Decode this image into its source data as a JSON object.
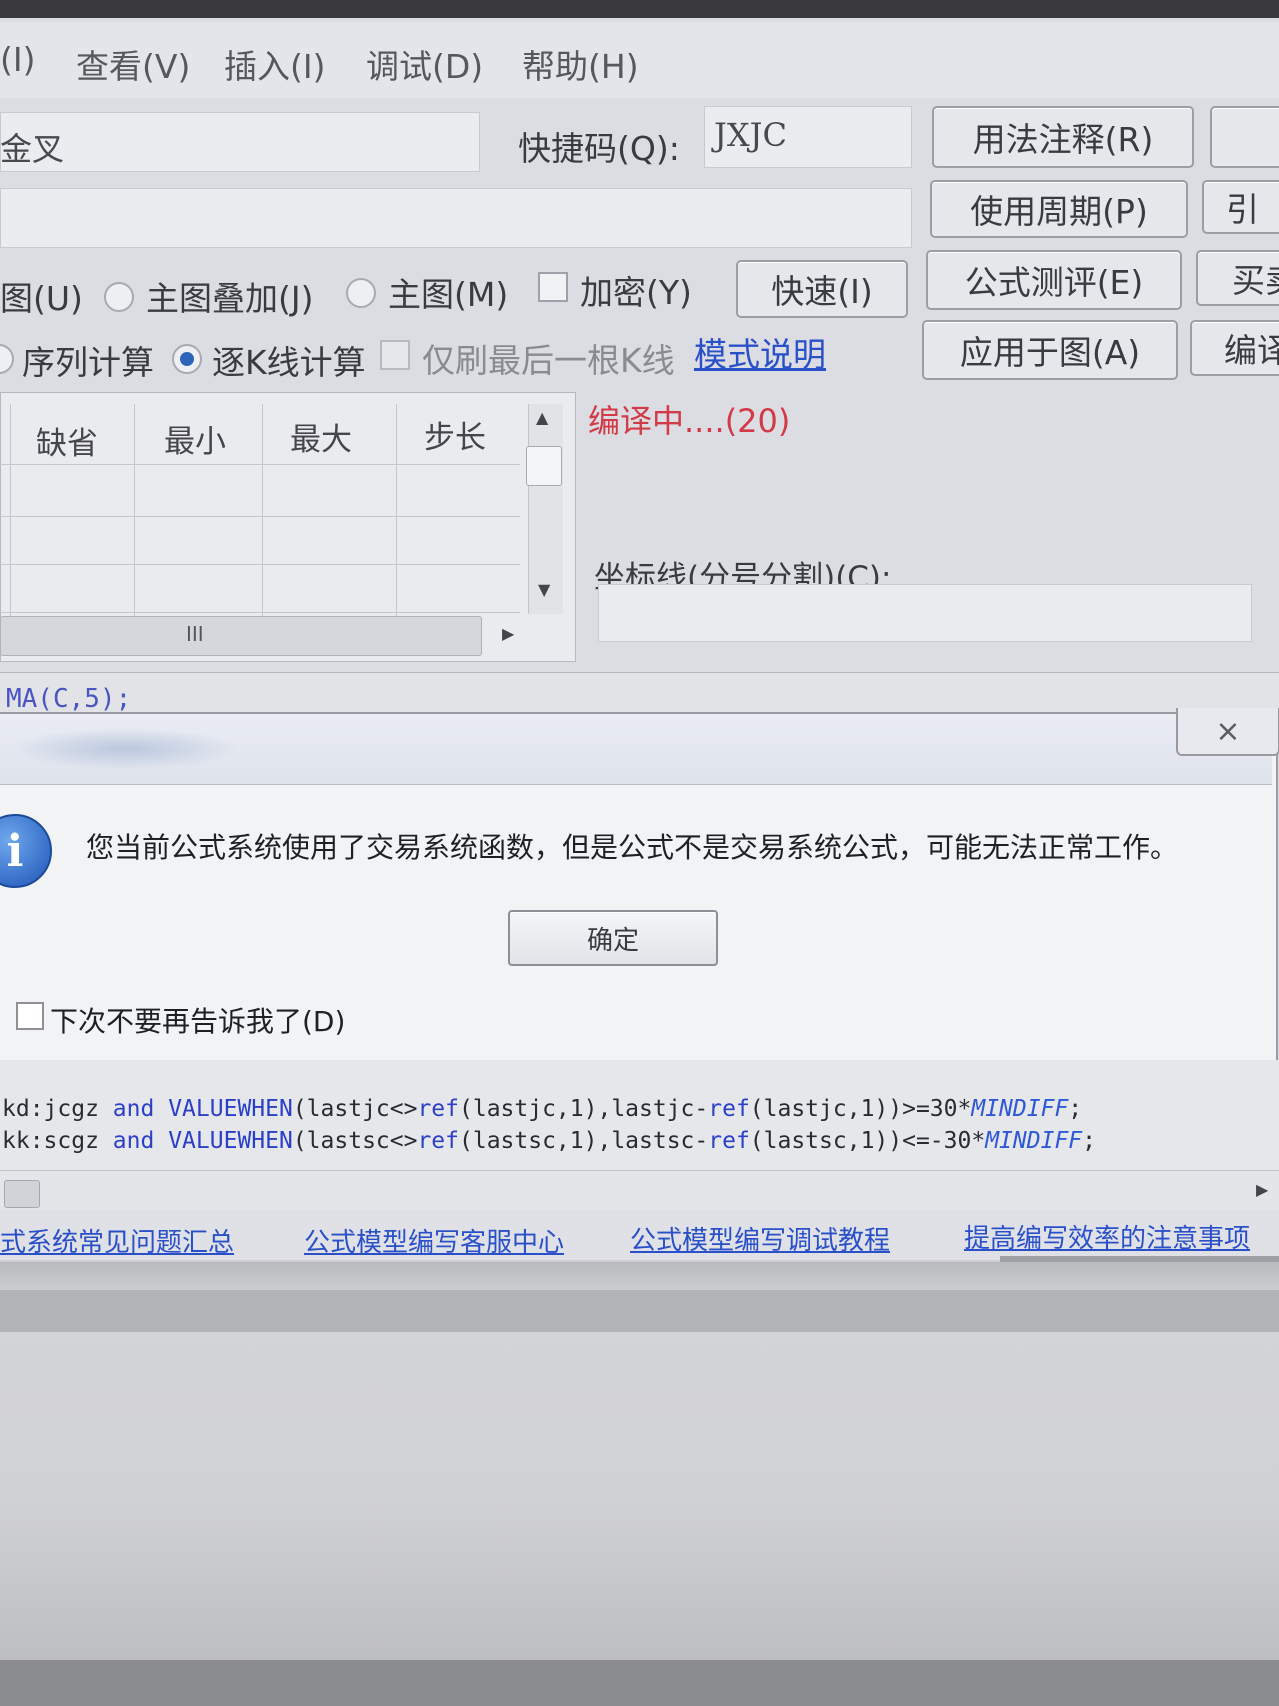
{
  "menu": {
    "items": [
      "(I)",
      "查看(V)",
      "插入(I)",
      "调试(D)",
      "帮助(H)"
    ]
  },
  "form": {
    "name_value": "金叉",
    "shortcut_label": "快捷码(Q):",
    "shortcut_value": "JXJC"
  },
  "buttons": {
    "usage_notes": "用法注释(R)",
    "period": "使用周期(P)",
    "evaluate": "公式测评(E)",
    "apply": "应用于图(A)",
    "fast": "快速(I)",
    "edge1": "",
    "edge2": "引",
    "edge3": "买卖",
    "edge4": "编译"
  },
  "options": {
    "sub_chart": "图(U)",
    "overlay": "主图叠加(J)",
    "main_chart": "主图(M)",
    "encrypt": "加密(Y)",
    "sequence_calc": "序列计算",
    "bar_calc": "逐K线计算",
    "last_bar_only": "仅刷最后一根K线",
    "mode_help": "模式说明"
  },
  "param_table": {
    "headers": [
      "缺省",
      "最小",
      "最大",
      "步长"
    ],
    "scroll_thumb": "III"
  },
  "compile": {
    "status": "编译中....(20)",
    "axis_label": "坐标线(分号分割)(C):"
  },
  "editor": {
    "line_top": "MA(C,5);",
    "line1": {
      "var": "kd:jcgz",
      "and": "and",
      "fn": "VALUEWHEN",
      "arg1a": "(lastjc<>",
      "ref1": "ref",
      "arg1b": "(lastjc,1),lastjc-",
      "ref2": "ref",
      "arg1c": "(lastjc,1))>=30*",
      "const": "MINDIFF",
      "end": ";"
    },
    "line2": {
      "var": "kk:scgz",
      "and": "and",
      "fn": "VALUEWHEN",
      "arg1a": "(lastsc<>",
      "ref1": "ref",
      "arg1b": "(lastsc,1),lastsc-",
      "ref2": "ref",
      "arg1c": "(lastsc,1))<=-30*",
      "const": "MINDIFF",
      "end": ";"
    }
  },
  "dialog": {
    "close_glyph": "⨯",
    "info_glyph": "i",
    "message": "您当前公式系统使用了交易系统函数，但是公式不是交易系统公式，可能无法正常工作。",
    "ok": "确定",
    "dont_tell": "下次不要再告诉我了(D)"
  },
  "links": [
    "式系统常见问题汇总",
    "公式模型编写客服中心",
    "公式模型编写调试教程",
    "提高编写效率的注意事项"
  ],
  "colors": {
    "accent_blue": "#2b64b8",
    "link": "#2a50c9",
    "compile_red": "#d23a48"
  }
}
